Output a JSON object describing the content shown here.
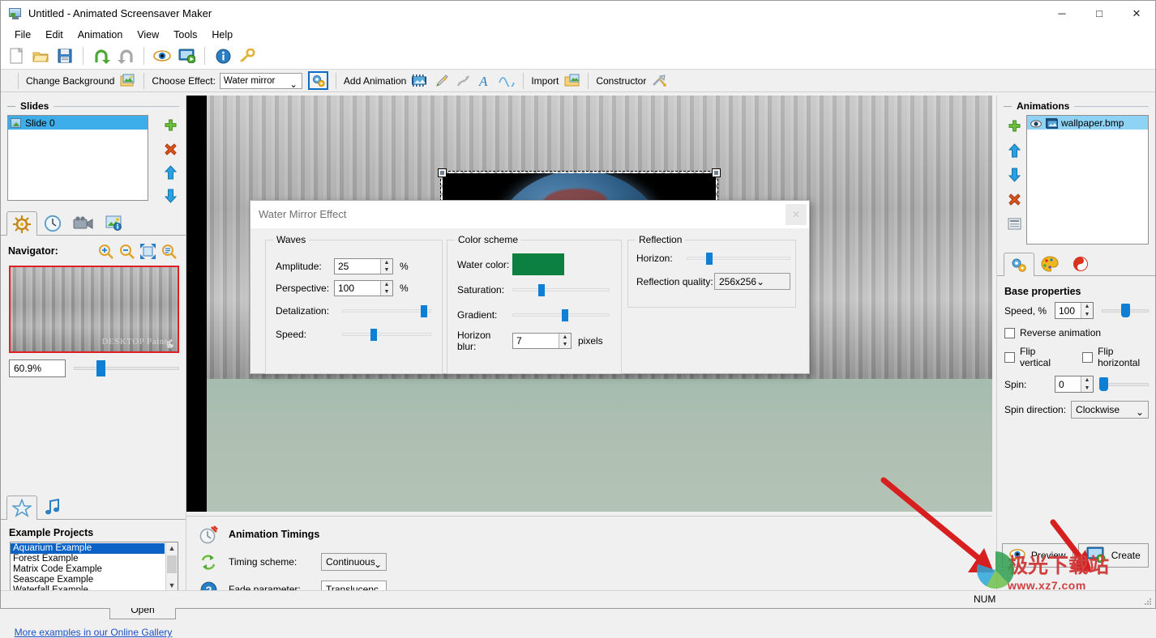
{
  "window": {
    "title": "Untitled - Animated Screensaver Maker",
    "app_icon": "monitor-picture-icon",
    "minimize": "─",
    "maximize": "□",
    "close": "✕"
  },
  "menu": {
    "items": [
      {
        "label": "File"
      },
      {
        "label": "Edit"
      },
      {
        "label": "Animation"
      },
      {
        "label": "View"
      },
      {
        "label": "Tools"
      },
      {
        "label": "Help"
      }
    ]
  },
  "toolbar_main": {
    "buttons": [
      {
        "name": "new-icon"
      },
      {
        "name": "open-folder-icon"
      },
      {
        "name": "save-icon"
      },
      {
        "name": "undo-icon"
      },
      {
        "name": "redo-icon"
      },
      {
        "name": "preview-eye-icon"
      },
      {
        "name": "run-screensaver-icon"
      },
      {
        "name": "info-icon"
      },
      {
        "name": "key-icon"
      }
    ]
  },
  "toolbar_effects": {
    "change_background": "Change Background",
    "choose_effect_label": "Choose Effect:",
    "effect_value": "Water mirror",
    "effect_options": [
      "Water mirror"
    ],
    "settings_icon": "gear-settings-icon",
    "add_animation": "Add Animation",
    "add_icons": [
      "video-frame-icon",
      "brush-icon",
      "particles-icon",
      "text-a-icon",
      "wave-icon"
    ],
    "import": "Import",
    "constructor": "Constructor",
    "chevron": "⌄"
  },
  "slides": {
    "title": "Slides",
    "items": [
      {
        "label": "Slide 0",
        "selected": true
      }
    ],
    "buttons": [
      "add-slide-icon",
      "delete-slide-icon",
      "move-up-icon",
      "move-down-icon"
    ],
    "tabs": [
      {
        "name": "tab-effects",
        "icon": "ship-wheel-icon",
        "active": true
      },
      {
        "name": "tab-timing",
        "icon": "clock-icon",
        "active": false
      },
      {
        "name": "tab-video",
        "icon": "video-camera-icon",
        "active": false
      },
      {
        "name": "tab-image-info",
        "icon": "image-info-icon",
        "active": false
      }
    ]
  },
  "navigator": {
    "title": "Navigator:",
    "buttons": [
      "zoom-in-icon",
      "zoom-out-icon",
      "fit-to-window-icon",
      "actual-size-icon"
    ],
    "zoom_value": "60.9%",
    "zoom_percent": 60.9,
    "thumbnail_watermark": "DESKTOP Paints"
  },
  "examples": {
    "tabs": [
      {
        "name": "tab-examples",
        "icon": "star-icon",
        "active": true
      },
      {
        "name": "tab-music",
        "icon": "music-note-icon",
        "active": false
      }
    ],
    "title": "Example Projects",
    "items": [
      {
        "label": "Aquarium Example",
        "selected": true
      },
      {
        "label": "Forest Example",
        "selected": false
      },
      {
        "label": "Matrix Code Example",
        "selected": false
      },
      {
        "label": "Seascape Example",
        "selected": false
      },
      {
        "label": "Waterfall Example",
        "selected": false
      }
    ],
    "open_button": "Open",
    "gallery_link": "More examples in our Online Gallery"
  },
  "timings": {
    "title": "Animation Timings",
    "title_icon": "stopwatch-icon",
    "scheme_icon": "loop-arrows-icon",
    "fade_icon": "question-help-icon",
    "scheme_label": "Timing scheme:",
    "scheme_value": "Continuous",
    "fade_label": "Fade parameter:",
    "fade_value": "Translucenc",
    "chevron": "⌄"
  },
  "animations": {
    "title": "Animations",
    "items": [
      {
        "label": "wallpaper.bmp",
        "selected": true,
        "visible": true
      }
    ],
    "buttons": [
      "add-animation-icon",
      "move-up-icon",
      "move-down-icon",
      "delete-animation-icon",
      "properties-icon"
    ],
    "tabs": [
      {
        "name": "tab-base-properties",
        "icon": "gears-icon",
        "active": true
      },
      {
        "name": "tab-color",
        "icon": "palette-icon",
        "active": false
      },
      {
        "name": "tab-motion",
        "icon": "spiral-icon",
        "active": false
      }
    ]
  },
  "base_properties": {
    "title": "Base properties",
    "speed_label": "Speed, %",
    "speed_value": "100",
    "speed_percent": 50,
    "reverse_label": "Reverse animation",
    "reverse_checked": false,
    "flip_vertical_label": "Flip vertical",
    "flip_vertical_checked": false,
    "flip_horizontal_label": "Flip horizontal",
    "flip_horizontal_checked": false,
    "spin_label": "Spin:",
    "spin_value": "0",
    "spin_percent": 3,
    "spin_direction_label": "Spin direction:",
    "spin_direction_value": "Clockwise",
    "chevron": "⌄"
  },
  "actions": {
    "preview": "Preview",
    "preview_icon": "eye-icon",
    "create": "Create",
    "create_icon": "monitor-create-icon"
  },
  "statusbar": {
    "num_lock": "NUM"
  },
  "dialog": {
    "title": "Water Mirror Effect",
    "close": "✕",
    "waves": {
      "legend": "Waves",
      "amplitude_label": "Amplitude:",
      "amplitude_value": "25",
      "amplitude_unit": "%",
      "perspective_label": "Perspective:",
      "perspective_value": "100",
      "perspective_unit": "%",
      "detalization_label": "Detalization:",
      "detalization_percent": 93,
      "speed_label": "Speed:",
      "speed_percent": 36
    },
    "color_scheme": {
      "legend": "Color scheme",
      "water_color_label": "Water color:",
      "water_color_hex": "#0b8041",
      "saturation_label": "Saturation:",
      "saturation_percent": 31,
      "gradient_label": "Gradient:",
      "gradient_percent": 55,
      "horizon_blur_label": "Horizon blur:",
      "horizon_blur_value": "7",
      "horizon_blur_unit": "pixels"
    },
    "reflection": {
      "legend": "Reflection",
      "horizon_label": "Horizon:",
      "horizon_percent": 23,
      "quality_label": "Reflection quality:",
      "quality_value": "256x256",
      "chevron": "⌄"
    }
  },
  "watermark": {
    "text_cn": "极光下载站",
    "url": "www.xz7.com"
  },
  "colors": {
    "accent_blue": "#0d7fd4",
    "selection_blue": "#3daee9",
    "list_select": "#0a62c7",
    "water_green": "#0b8041",
    "arrow_red": "#e02020"
  }
}
